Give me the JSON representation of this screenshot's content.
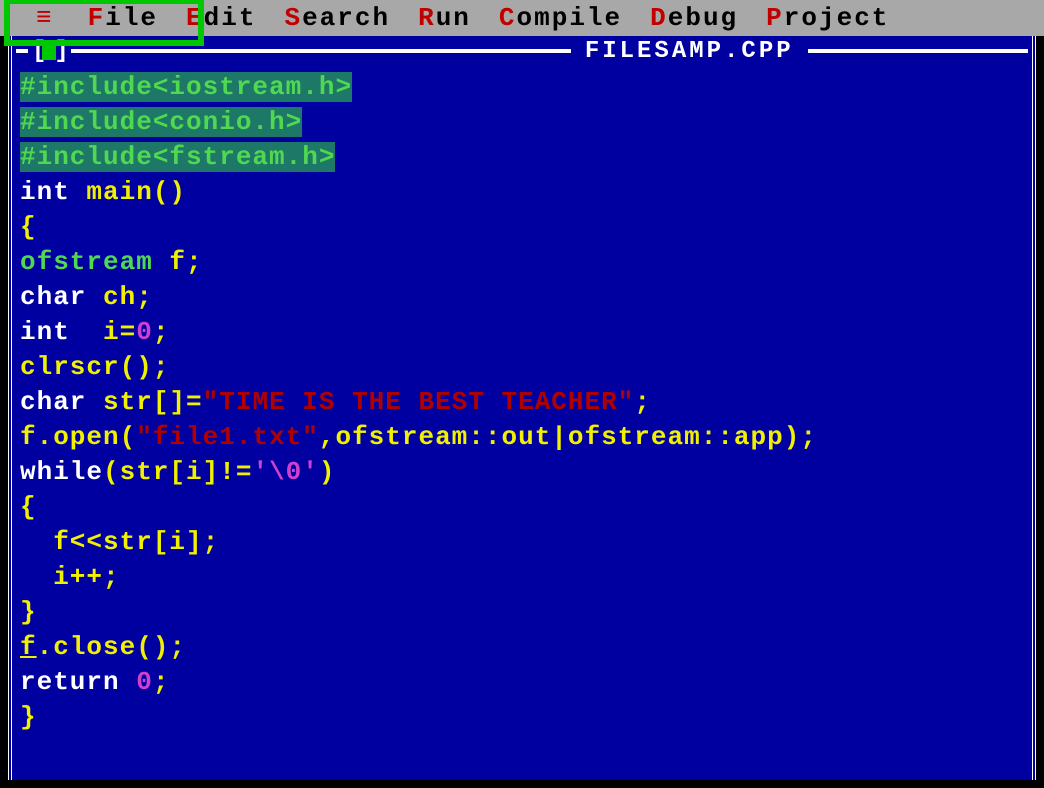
{
  "menu": {
    "hamburger": "≡",
    "items": [
      {
        "hot": "F",
        "rest": "ile"
      },
      {
        "hot": "E",
        "rest": "dit"
      },
      {
        "hot": "S",
        "rest": "earch"
      },
      {
        "hot": "R",
        "rest": "un"
      },
      {
        "hot": "C",
        "rest": "ompile"
      },
      {
        "hot": "D",
        "rest": "ebug"
      },
      {
        "hot": "P",
        "rest": "roject"
      }
    ]
  },
  "window": {
    "close_l": "[",
    "close_r": "]",
    "filename": "FILESAMP.CPP"
  },
  "code": {
    "l1": "#include<iostream.h>",
    "l2": "#include<conio.h>",
    "l3": "#include<fstream.h>",
    "l4a": "int",
    "l4b": " main()",
    "l5": "{",
    "l6a": "ofstream",
    "l6b": " f;",
    "l7a": "char",
    "l7b": " ch;",
    "l8a": "int",
    "l8b": "  i=",
    "l8c": "0",
    "l8d": ";",
    "l9": "clrscr();",
    "l10a": "char",
    "l10b": " str[]=",
    "l10c": "\"TIME IS THE BEST TEACHER\"",
    "l10d": ";",
    "l11a": "f.open(",
    "l11b": "\"file1.txt\"",
    "l11c": ",ofstream::out|ofstream::app);",
    "l12a": "while",
    "l12b": "(str[i]!=",
    "l12c": "'\\0'",
    "l12d": ")",
    "l13": "{",
    "l14": "  f<<str[i];",
    "l15": "  i++;",
    "l16": "}",
    "l17a": "f",
    "l17b": ".close();",
    "l18a": "return",
    "l18b": " 0",
    "l18c": ";",
    "l19": "}"
  }
}
